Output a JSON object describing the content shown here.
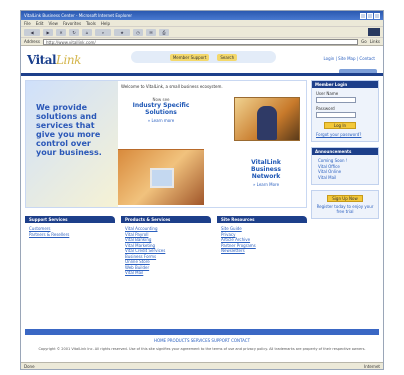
{
  "browser": {
    "title": "VitalLink Business Center - Microsoft Internet Explorer",
    "menu": [
      "File",
      "Edit",
      "View",
      "Favorites",
      "Tools",
      "Help"
    ],
    "toolbar": [
      "Back",
      "Forward",
      "Stop",
      "Refresh",
      "Home",
      "Search",
      "Favorites",
      "History",
      "Mail",
      "Print"
    ],
    "address_label": "Address",
    "address_value": "http://www.vitallink.com/",
    "go_label": "Go",
    "links_label": "Links",
    "status_left": "Done",
    "status_zone": "Internet"
  },
  "site": {
    "logo_main": "Vital",
    "logo_accent": "Link",
    "pill_left": "Member Support",
    "pill_right": "Search",
    "header_links": "Login | Site Map | Contact"
  },
  "hero": {
    "headline": "We provide solutions and services that give you more control over your business.",
    "intro": "Welcome to VitalLink, a small business ecosystem.",
    "promo1_small": "Now see",
    "promo1_big": "Industry Specific Solutions",
    "promo1_learn": "» Learn more",
    "promo2_big": "VitalLink Business Network",
    "promo2_learn": "» Learn More"
  },
  "sections": [
    {
      "title": "Support Services",
      "items": [
        "Customers",
        "Partners & Resellers"
      ]
    },
    {
      "title": "Products & Services",
      "items": [
        "Vital Accounting",
        "Vital Payroll",
        "Vital Banking",
        "Vital Marketing",
        "Vital Credit Services",
        "Business Forms",
        "Online Store",
        "Web Builder",
        "Vital Mail"
      ]
    },
    {
      "title": "Site Resources",
      "items": [
        "Site Guide",
        "Privacy",
        "Article Archive",
        "Partner Programs",
        "Newsletters"
      ]
    }
  ],
  "login": {
    "title": "Member Login",
    "user_label": "User Name",
    "pass_label": "Password",
    "button": "Log In",
    "forgot": "Forgot your password?"
  },
  "announcements": {
    "title": "Announcements",
    "items": [
      "Coming Soon !",
      "Vital Office",
      "Vital Online",
      "Vital Mail"
    ]
  },
  "promo": {
    "button": "Sign Up Now",
    "text": "Register today to enjoy your free trial"
  },
  "footer": {
    "links": "HOME  PRODUCTS  SERVICES  SUPPORT  CONTACT",
    "copyright": "Copyright © 2001 VitalLink Inc. All rights reserved. Use of this site signifies your agreement to the terms of use and privacy policy. All trademarks are property of their respective owners."
  },
  "colors": {
    "primary": "#1d3f8a",
    "link": "#2a5fbf",
    "accent_yellow": "#f3c83a"
  }
}
